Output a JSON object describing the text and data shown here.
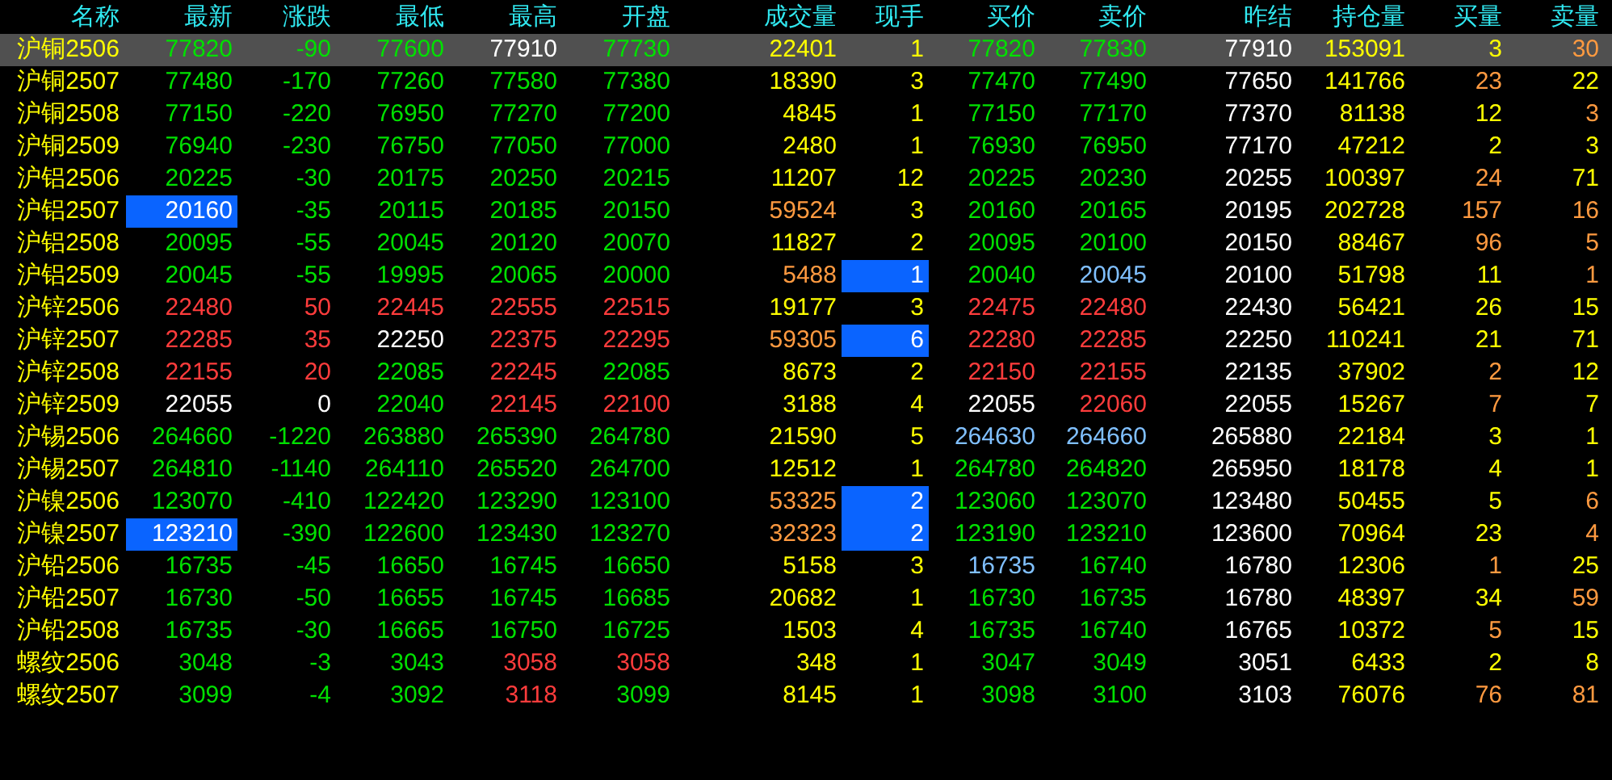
{
  "columns": [
    "名称",
    "最新",
    "涨跌",
    "最低",
    "最高",
    "开盘",
    "成交量",
    "现手",
    "买价",
    "卖价",
    "昨结",
    "持仓量",
    "买量",
    "卖量"
  ],
  "rows": [
    {
      "name": "沪铜2506",
      "selected": true,
      "cells": [
        {
          "text": "77820",
          "color": "#00e000",
          "highlighted": false
        },
        {
          "text": "-90",
          "color": "#00e000",
          "highlighted": false
        },
        {
          "text": "77600",
          "color": "#00e000",
          "highlighted": false
        },
        {
          "text": "77910",
          "color": "#ffffff",
          "highlighted": false
        },
        {
          "text": "77730",
          "color": "#00e000",
          "highlighted": false
        },
        {
          "text": "22401",
          "color": "#ffff00",
          "highlighted": false
        },
        {
          "text": "1",
          "color": "#ffff00",
          "highlighted": false
        },
        {
          "text": "77820",
          "color": "#00e000",
          "highlighted": false
        },
        {
          "text": "77830",
          "color": "#00e000",
          "highlighted": false
        },
        {
          "text": "77910",
          "color": "#ffffff",
          "highlighted": false
        },
        {
          "text": "153091",
          "color": "#ffff00",
          "highlighted": false
        },
        {
          "text": "3",
          "color": "#ffff00",
          "highlighted": false
        },
        {
          "text": "30",
          "color": "#ff9a40",
          "highlighted": false
        }
      ]
    },
    {
      "name": "沪铜2507",
      "selected": false,
      "cells": [
        {
          "text": "77480",
          "color": "#00e000",
          "highlighted": false
        },
        {
          "text": "-170",
          "color": "#00e000",
          "highlighted": false
        },
        {
          "text": "77260",
          "color": "#00e000",
          "highlighted": false
        },
        {
          "text": "77580",
          "color": "#00e000",
          "highlighted": false
        },
        {
          "text": "77380",
          "color": "#00e000",
          "highlighted": false
        },
        {
          "text": "18390",
          "color": "#ffff00",
          "highlighted": false
        },
        {
          "text": "3",
          "color": "#ffff00",
          "highlighted": false
        },
        {
          "text": "77470",
          "color": "#00e000",
          "highlighted": false
        },
        {
          "text": "77490",
          "color": "#00e000",
          "highlighted": false
        },
        {
          "text": "77650",
          "color": "#ffffff",
          "highlighted": false
        },
        {
          "text": "141766",
          "color": "#ffff00",
          "highlighted": false
        },
        {
          "text": "23",
          "color": "#ff9a40",
          "highlighted": false
        },
        {
          "text": "22",
          "color": "#ffff00",
          "highlighted": false
        }
      ]
    },
    {
      "name": "沪铜2508",
      "selected": false,
      "cells": [
        {
          "text": "77150",
          "color": "#00e000",
          "highlighted": false
        },
        {
          "text": "-220",
          "color": "#00e000",
          "highlighted": false
        },
        {
          "text": "76950",
          "color": "#00e000",
          "highlighted": false
        },
        {
          "text": "77270",
          "color": "#00e000",
          "highlighted": false
        },
        {
          "text": "77200",
          "color": "#00e000",
          "highlighted": false
        },
        {
          "text": "4845",
          "color": "#ffff00",
          "highlighted": false
        },
        {
          "text": "1",
          "color": "#ffff00",
          "highlighted": false
        },
        {
          "text": "77150",
          "color": "#00e000",
          "highlighted": false
        },
        {
          "text": "77170",
          "color": "#00e000",
          "highlighted": false
        },
        {
          "text": "77370",
          "color": "#ffffff",
          "highlighted": false
        },
        {
          "text": "81138",
          "color": "#ffff00",
          "highlighted": false
        },
        {
          "text": "12",
          "color": "#ffff00",
          "highlighted": false
        },
        {
          "text": "3",
          "color": "#ff9a40",
          "highlighted": false
        }
      ]
    },
    {
      "name": "沪铜2509",
      "selected": false,
      "cells": [
        {
          "text": "76940",
          "color": "#00e000",
          "highlighted": false
        },
        {
          "text": "-230",
          "color": "#00e000",
          "highlighted": false
        },
        {
          "text": "76750",
          "color": "#00e000",
          "highlighted": false
        },
        {
          "text": "77050",
          "color": "#00e000",
          "highlighted": false
        },
        {
          "text": "77000",
          "color": "#00e000",
          "highlighted": false
        },
        {
          "text": "2480",
          "color": "#ffff00",
          "highlighted": false
        },
        {
          "text": "1",
          "color": "#ffff00",
          "highlighted": false
        },
        {
          "text": "76930",
          "color": "#00e000",
          "highlighted": false
        },
        {
          "text": "76950",
          "color": "#00e000",
          "highlighted": false
        },
        {
          "text": "77170",
          "color": "#ffffff",
          "highlighted": false
        },
        {
          "text": "47212",
          "color": "#ffff00",
          "highlighted": false
        },
        {
          "text": "2",
          "color": "#ffff00",
          "highlighted": false
        },
        {
          "text": "3",
          "color": "#ffff00",
          "highlighted": false
        }
      ]
    },
    {
      "name": "沪铝2506",
      "selected": false,
      "cells": [
        {
          "text": "20225",
          "color": "#00e000",
          "highlighted": false
        },
        {
          "text": "-30",
          "color": "#00e000",
          "highlighted": false
        },
        {
          "text": "20175",
          "color": "#00e000",
          "highlighted": false
        },
        {
          "text": "20250",
          "color": "#00e000",
          "highlighted": false
        },
        {
          "text": "20215",
          "color": "#00e000",
          "highlighted": false
        },
        {
          "text": "11207",
          "color": "#ffff00",
          "highlighted": false
        },
        {
          "text": "12",
          "color": "#ffff00",
          "highlighted": false
        },
        {
          "text": "20225",
          "color": "#00e000",
          "highlighted": false
        },
        {
          "text": "20230",
          "color": "#00e000",
          "highlighted": false
        },
        {
          "text": "20255",
          "color": "#ffffff",
          "highlighted": false
        },
        {
          "text": "100397",
          "color": "#ffff00",
          "highlighted": false
        },
        {
          "text": "24",
          "color": "#ff9a40",
          "highlighted": false
        },
        {
          "text": "71",
          "color": "#ffff00",
          "highlighted": false
        }
      ]
    },
    {
      "name": "沪铝2507",
      "selected": false,
      "cells": [
        {
          "text": "20160",
          "color": "#ffffff",
          "highlighted": true
        },
        {
          "text": "-35",
          "color": "#00e000",
          "highlighted": false
        },
        {
          "text": "20115",
          "color": "#00e000",
          "highlighted": false
        },
        {
          "text": "20185",
          "color": "#00e000",
          "highlighted": false
        },
        {
          "text": "20150",
          "color": "#00e000",
          "highlighted": false
        },
        {
          "text": "59524",
          "color": "#ff9a40",
          "highlighted": false
        },
        {
          "text": "3",
          "color": "#ffff00",
          "highlighted": false
        },
        {
          "text": "20160",
          "color": "#00e000",
          "highlighted": false
        },
        {
          "text": "20165",
          "color": "#00e000",
          "highlighted": false
        },
        {
          "text": "20195",
          "color": "#ffffff",
          "highlighted": false
        },
        {
          "text": "202728",
          "color": "#ffff00",
          "highlighted": false
        },
        {
          "text": "157",
          "color": "#ff9a40",
          "highlighted": false
        },
        {
          "text": "16",
          "color": "#ff9a40",
          "highlighted": false
        }
      ]
    },
    {
      "name": "沪铝2508",
      "selected": false,
      "cells": [
        {
          "text": "20095",
          "color": "#00e000",
          "highlighted": false
        },
        {
          "text": "-55",
          "color": "#00e000",
          "highlighted": false
        },
        {
          "text": "20045",
          "color": "#00e000",
          "highlighted": false
        },
        {
          "text": "20120",
          "color": "#00e000",
          "highlighted": false
        },
        {
          "text": "20070",
          "color": "#00e000",
          "highlighted": false
        },
        {
          "text": "11827",
          "color": "#ffff00",
          "highlighted": false
        },
        {
          "text": "2",
          "color": "#ffff00",
          "highlighted": false
        },
        {
          "text": "20095",
          "color": "#00e000",
          "highlighted": false
        },
        {
          "text": "20100",
          "color": "#00e000",
          "highlighted": false
        },
        {
          "text": "20150",
          "color": "#ffffff",
          "highlighted": false
        },
        {
          "text": "88467",
          "color": "#ffff00",
          "highlighted": false
        },
        {
          "text": "96",
          "color": "#ff9a40",
          "highlighted": false
        },
        {
          "text": "5",
          "color": "#ff9a40",
          "highlighted": false
        }
      ]
    },
    {
      "name": "沪铝2509",
      "selected": false,
      "cells": [
        {
          "text": "20045",
          "color": "#00e000",
          "highlighted": false
        },
        {
          "text": "-55",
          "color": "#00e000",
          "highlighted": false
        },
        {
          "text": "19995",
          "color": "#00e000",
          "highlighted": false
        },
        {
          "text": "20065",
          "color": "#00e000",
          "highlighted": false
        },
        {
          "text": "20000",
          "color": "#00e000",
          "highlighted": false
        },
        {
          "text": "5488",
          "color": "#ff9a40",
          "highlighted": false
        },
        {
          "text": "1",
          "color": "#ffffff",
          "highlighted": true
        },
        {
          "text": "20040",
          "color": "#00e000",
          "highlighted": false
        },
        {
          "text": "20045",
          "color": "#80c0ff",
          "highlighted": false
        },
        {
          "text": "20100",
          "color": "#ffffff",
          "highlighted": false
        },
        {
          "text": "51798",
          "color": "#ffff00",
          "highlighted": false
        },
        {
          "text": "11",
          "color": "#ffff00",
          "highlighted": false
        },
        {
          "text": "1",
          "color": "#ff9a40",
          "highlighted": false
        }
      ]
    },
    {
      "name": "沪锌2506",
      "selected": false,
      "cells": [
        {
          "text": "22480",
          "color": "#ff3c3c",
          "highlighted": false
        },
        {
          "text": "50",
          "color": "#ff3c3c",
          "highlighted": false
        },
        {
          "text": "22445",
          "color": "#ff3c3c",
          "highlighted": false
        },
        {
          "text": "22555",
          "color": "#ff3c3c",
          "highlighted": false
        },
        {
          "text": "22515",
          "color": "#ff3c3c",
          "highlighted": false
        },
        {
          "text": "19177",
          "color": "#ffff00",
          "highlighted": false
        },
        {
          "text": "3",
          "color": "#ffff00",
          "highlighted": false
        },
        {
          "text": "22475",
          "color": "#ff3c3c",
          "highlighted": false
        },
        {
          "text": "22480",
          "color": "#ff3c3c",
          "highlighted": false
        },
        {
          "text": "22430",
          "color": "#ffffff",
          "highlighted": false
        },
        {
          "text": "56421",
          "color": "#ffff00",
          "highlighted": false
        },
        {
          "text": "26",
          "color": "#ffff00",
          "highlighted": false
        },
        {
          "text": "15",
          "color": "#ffff00",
          "highlighted": false
        }
      ]
    },
    {
      "name": "沪锌2507",
      "selected": false,
      "cells": [
        {
          "text": "22285",
          "color": "#ff3c3c",
          "highlighted": false
        },
        {
          "text": "35",
          "color": "#ff3c3c",
          "highlighted": false
        },
        {
          "text": "22250",
          "color": "#ffffff",
          "highlighted": false
        },
        {
          "text": "22375",
          "color": "#ff3c3c",
          "highlighted": false
        },
        {
          "text": "22295",
          "color": "#ff3c3c",
          "highlighted": false
        },
        {
          "text": "59305",
          "color": "#ff9a40",
          "highlighted": false
        },
        {
          "text": "6",
          "color": "#ffffff",
          "highlighted": true
        },
        {
          "text": "22280",
          "color": "#ff3c3c",
          "highlighted": false
        },
        {
          "text": "22285",
          "color": "#ff3c3c",
          "highlighted": false
        },
        {
          "text": "22250",
          "color": "#ffffff",
          "highlighted": false
        },
        {
          "text": "110241",
          "color": "#ffff00",
          "highlighted": false
        },
        {
          "text": "21",
          "color": "#ffff00",
          "highlighted": false
        },
        {
          "text": "71",
          "color": "#ffff00",
          "highlighted": false
        }
      ]
    },
    {
      "name": "沪锌2508",
      "selected": false,
      "cells": [
        {
          "text": "22155",
          "color": "#ff3c3c",
          "highlighted": false
        },
        {
          "text": "20",
          "color": "#ff3c3c",
          "highlighted": false
        },
        {
          "text": "22085",
          "color": "#00e000",
          "highlighted": false
        },
        {
          "text": "22245",
          "color": "#ff3c3c",
          "highlighted": false
        },
        {
          "text": "22085",
          "color": "#00e000",
          "highlighted": false
        },
        {
          "text": "8673",
          "color": "#ffff00",
          "highlighted": false
        },
        {
          "text": "2",
          "color": "#ffff00",
          "highlighted": false
        },
        {
          "text": "22150",
          "color": "#ff3c3c",
          "highlighted": false
        },
        {
          "text": "22155",
          "color": "#ff3c3c",
          "highlighted": false
        },
        {
          "text": "22135",
          "color": "#ffffff",
          "highlighted": false
        },
        {
          "text": "37902",
          "color": "#ffff00",
          "highlighted": false
        },
        {
          "text": "2",
          "color": "#ff9a40",
          "highlighted": false
        },
        {
          "text": "12",
          "color": "#ffff00",
          "highlighted": false
        }
      ]
    },
    {
      "name": "沪锌2509",
      "selected": false,
      "cells": [
        {
          "text": "22055",
          "color": "#ffffff",
          "highlighted": false
        },
        {
          "text": "0",
          "color": "#ffffff",
          "highlighted": false
        },
        {
          "text": "22040",
          "color": "#00e000",
          "highlighted": false
        },
        {
          "text": "22145",
          "color": "#ff3c3c",
          "highlighted": false
        },
        {
          "text": "22100",
          "color": "#ff3c3c",
          "highlighted": false
        },
        {
          "text": "3188",
          "color": "#ffff00",
          "highlighted": false
        },
        {
          "text": "4",
          "color": "#ffff00",
          "highlighted": false
        },
        {
          "text": "22055",
          "color": "#ffffff",
          "highlighted": false
        },
        {
          "text": "22060",
          "color": "#ff3c3c",
          "highlighted": false
        },
        {
          "text": "22055",
          "color": "#ffffff",
          "highlighted": false
        },
        {
          "text": "15267",
          "color": "#ffff00",
          "highlighted": false
        },
        {
          "text": "7",
          "color": "#ff9a40",
          "highlighted": false
        },
        {
          "text": "7",
          "color": "#ffff00",
          "highlighted": false
        }
      ]
    },
    {
      "name": "沪锡2506",
      "selected": false,
      "cells": [
        {
          "text": "264660",
          "color": "#00e000",
          "highlighted": false
        },
        {
          "text": "-1220",
          "color": "#00e000",
          "highlighted": false
        },
        {
          "text": "263880",
          "color": "#00e000",
          "highlighted": false
        },
        {
          "text": "265390",
          "color": "#00e000",
          "highlighted": false
        },
        {
          "text": "264780",
          "color": "#00e000",
          "highlighted": false
        },
        {
          "text": "21590",
          "color": "#ffff00",
          "highlighted": false
        },
        {
          "text": "5",
          "color": "#ffff00",
          "highlighted": false
        },
        {
          "text": "264630",
          "color": "#80c0ff",
          "highlighted": false
        },
        {
          "text": "264660",
          "color": "#80c0ff",
          "highlighted": false
        },
        {
          "text": "265880",
          "color": "#ffffff",
          "highlighted": false
        },
        {
          "text": "22184",
          "color": "#ffff00",
          "highlighted": false
        },
        {
          "text": "3",
          "color": "#ffff00",
          "highlighted": false
        },
        {
          "text": "1",
          "color": "#ffff00",
          "highlighted": false
        }
      ]
    },
    {
      "name": "沪锡2507",
      "selected": false,
      "cells": [
        {
          "text": "264810",
          "color": "#00e000",
          "highlighted": false
        },
        {
          "text": "-1140",
          "color": "#00e000",
          "highlighted": false
        },
        {
          "text": "264110",
          "color": "#00e000",
          "highlighted": false
        },
        {
          "text": "265520",
          "color": "#00e000",
          "highlighted": false
        },
        {
          "text": "264700",
          "color": "#00e000",
          "highlighted": false
        },
        {
          "text": "12512",
          "color": "#ffff00",
          "highlighted": false
        },
        {
          "text": "1",
          "color": "#ffff00",
          "highlighted": false
        },
        {
          "text": "264780",
          "color": "#00e000",
          "highlighted": false
        },
        {
          "text": "264820",
          "color": "#00e000",
          "highlighted": false
        },
        {
          "text": "265950",
          "color": "#ffffff",
          "highlighted": false
        },
        {
          "text": "18178",
          "color": "#ffff00",
          "highlighted": false
        },
        {
          "text": "4",
          "color": "#ffff00",
          "highlighted": false
        },
        {
          "text": "1",
          "color": "#ffff00",
          "highlighted": false
        }
      ]
    },
    {
      "name": "沪镍2506",
      "selected": false,
      "cells": [
        {
          "text": "123070",
          "color": "#00e000",
          "highlighted": false
        },
        {
          "text": "-410",
          "color": "#00e000",
          "highlighted": false
        },
        {
          "text": "122420",
          "color": "#00e000",
          "highlighted": false
        },
        {
          "text": "123290",
          "color": "#00e000",
          "highlighted": false
        },
        {
          "text": "123100",
          "color": "#00e000",
          "highlighted": false
        },
        {
          "text": "53325",
          "color": "#ff9a40",
          "highlighted": false
        },
        {
          "text": "2",
          "color": "#ffffff",
          "highlighted": true
        },
        {
          "text": "123060",
          "color": "#00e000",
          "highlighted": false
        },
        {
          "text": "123070",
          "color": "#00e000",
          "highlighted": false
        },
        {
          "text": "123480",
          "color": "#ffffff",
          "highlighted": false
        },
        {
          "text": "50455",
          "color": "#ffff00",
          "highlighted": false
        },
        {
          "text": "5",
          "color": "#ffff00",
          "highlighted": false
        },
        {
          "text": "6",
          "color": "#ff9a40",
          "highlighted": false
        }
      ]
    },
    {
      "name": "沪镍2507",
      "selected": false,
      "cells": [
        {
          "text": "123210",
          "color": "#ffffff",
          "highlighted": true
        },
        {
          "text": "-390",
          "color": "#00e000",
          "highlighted": false
        },
        {
          "text": "122600",
          "color": "#00e000",
          "highlighted": false
        },
        {
          "text": "123430",
          "color": "#00e000",
          "highlighted": false
        },
        {
          "text": "123270",
          "color": "#00e000",
          "highlighted": false
        },
        {
          "text": "32323",
          "color": "#ff9a40",
          "highlighted": false
        },
        {
          "text": "2",
          "color": "#ffffff",
          "highlighted": true
        },
        {
          "text": "123190",
          "color": "#00e000",
          "highlighted": false
        },
        {
          "text": "123210",
          "color": "#00e000",
          "highlighted": false
        },
        {
          "text": "123600",
          "color": "#ffffff",
          "highlighted": false
        },
        {
          "text": "70964",
          "color": "#ffff00",
          "highlighted": false
        },
        {
          "text": "23",
          "color": "#ffff00",
          "highlighted": false
        },
        {
          "text": "4",
          "color": "#ff9a40",
          "highlighted": false
        }
      ]
    },
    {
      "name": "沪铅2506",
      "selected": false,
      "cells": [
        {
          "text": "16735",
          "color": "#00e000",
          "highlighted": false
        },
        {
          "text": "-45",
          "color": "#00e000",
          "highlighted": false
        },
        {
          "text": "16650",
          "color": "#00e000",
          "highlighted": false
        },
        {
          "text": "16745",
          "color": "#00e000",
          "highlighted": false
        },
        {
          "text": "16650",
          "color": "#00e000",
          "highlighted": false
        },
        {
          "text": "5158",
          "color": "#ffff00",
          "highlighted": false
        },
        {
          "text": "3",
          "color": "#ffff00",
          "highlighted": false
        },
        {
          "text": "16735",
          "color": "#80c0ff",
          "highlighted": false
        },
        {
          "text": "16740",
          "color": "#00e000",
          "highlighted": false
        },
        {
          "text": "16780",
          "color": "#ffffff",
          "highlighted": false
        },
        {
          "text": "12306",
          "color": "#ffff00",
          "highlighted": false
        },
        {
          "text": "1",
          "color": "#ff9a40",
          "highlighted": false
        },
        {
          "text": "25",
          "color": "#ffff00",
          "highlighted": false
        }
      ]
    },
    {
      "name": "沪铅2507",
      "selected": false,
      "cells": [
        {
          "text": "16730",
          "color": "#00e000",
          "highlighted": false
        },
        {
          "text": "-50",
          "color": "#00e000",
          "highlighted": false
        },
        {
          "text": "16655",
          "color": "#00e000",
          "highlighted": false
        },
        {
          "text": "16745",
          "color": "#00e000",
          "highlighted": false
        },
        {
          "text": "16685",
          "color": "#00e000",
          "highlighted": false
        },
        {
          "text": "20682",
          "color": "#ffff00",
          "highlighted": false
        },
        {
          "text": "1",
          "color": "#ffff00",
          "highlighted": false
        },
        {
          "text": "16730",
          "color": "#00e000",
          "highlighted": false
        },
        {
          "text": "16735",
          "color": "#00e000",
          "highlighted": false
        },
        {
          "text": "16780",
          "color": "#ffffff",
          "highlighted": false
        },
        {
          "text": "48397",
          "color": "#ffff00",
          "highlighted": false
        },
        {
          "text": "34",
          "color": "#ffff00",
          "highlighted": false
        },
        {
          "text": "59",
          "color": "#ff9a40",
          "highlighted": false
        }
      ]
    },
    {
      "name": "沪铅2508",
      "selected": false,
      "cells": [
        {
          "text": "16735",
          "color": "#00e000",
          "highlighted": false
        },
        {
          "text": "-30",
          "color": "#00e000",
          "highlighted": false
        },
        {
          "text": "16665",
          "color": "#00e000",
          "highlighted": false
        },
        {
          "text": "16750",
          "color": "#00e000",
          "highlighted": false
        },
        {
          "text": "16725",
          "color": "#00e000",
          "highlighted": false
        },
        {
          "text": "1503",
          "color": "#ffff00",
          "highlighted": false
        },
        {
          "text": "4",
          "color": "#ffff00",
          "highlighted": false
        },
        {
          "text": "16735",
          "color": "#00e000",
          "highlighted": false
        },
        {
          "text": "16740",
          "color": "#00e000",
          "highlighted": false
        },
        {
          "text": "16765",
          "color": "#ffffff",
          "highlighted": false
        },
        {
          "text": "10372",
          "color": "#ffff00",
          "highlighted": false
        },
        {
          "text": "5",
          "color": "#ff9a40",
          "highlighted": false
        },
        {
          "text": "15",
          "color": "#ffff00",
          "highlighted": false
        }
      ]
    },
    {
      "name": "螺纹2506",
      "selected": false,
      "cells": [
        {
          "text": "3048",
          "color": "#00e000",
          "highlighted": false
        },
        {
          "text": "-3",
          "color": "#00e000",
          "highlighted": false
        },
        {
          "text": "3043",
          "color": "#00e000",
          "highlighted": false
        },
        {
          "text": "3058",
          "color": "#ff3c3c",
          "highlighted": false
        },
        {
          "text": "3058",
          "color": "#ff3c3c",
          "highlighted": false
        },
        {
          "text": "348",
          "color": "#ffff00",
          "highlighted": false
        },
        {
          "text": "1",
          "color": "#ffff00",
          "highlighted": false
        },
        {
          "text": "3047",
          "color": "#00e000",
          "highlighted": false
        },
        {
          "text": "3049",
          "color": "#00e000",
          "highlighted": false
        },
        {
          "text": "3051",
          "color": "#ffffff",
          "highlighted": false
        },
        {
          "text": "6433",
          "color": "#ffff00",
          "highlighted": false
        },
        {
          "text": "2",
          "color": "#ffff00",
          "highlighted": false
        },
        {
          "text": "8",
          "color": "#ffff00",
          "highlighted": false
        }
      ]
    },
    {
      "name": "螺纹2507",
      "selected": false,
      "cells": [
        {
          "text": "3099",
          "color": "#00e000",
          "highlighted": false
        },
        {
          "text": "-4",
          "color": "#00e000",
          "highlighted": false
        },
        {
          "text": "3092",
          "color": "#00e000",
          "highlighted": false
        },
        {
          "text": "3118",
          "color": "#ff3c3c",
          "highlighted": false
        },
        {
          "text": "3099",
          "color": "#00e000",
          "highlighted": false
        },
        {
          "text": "8145",
          "color": "#ffff00",
          "highlighted": false
        },
        {
          "text": "1",
          "color": "#ffff00",
          "highlighted": false
        },
        {
          "text": "3098",
          "color": "#00e000",
          "highlighted": false
        },
        {
          "text": "3100",
          "color": "#00e000",
          "highlighted": false
        },
        {
          "text": "3103",
          "color": "#ffffff",
          "highlighted": false
        },
        {
          "text": "76076",
          "color": "#ffff00",
          "highlighted": false
        },
        {
          "text": "76",
          "color": "#ff9a40",
          "highlighted": false
        },
        {
          "text": "81",
          "color": "#ff9a40",
          "highlighted": false
        }
      ]
    }
  ]
}
